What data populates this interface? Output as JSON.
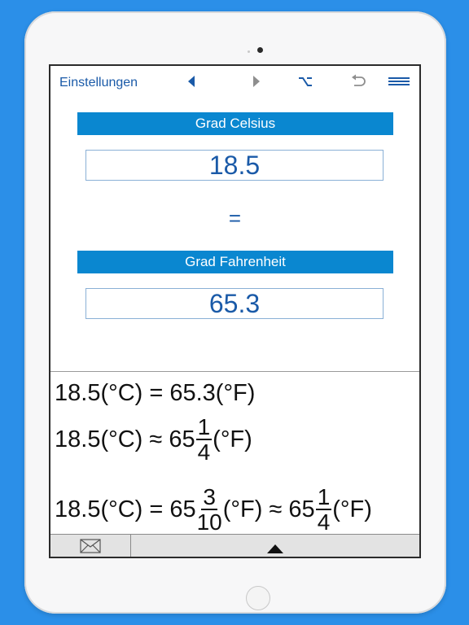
{
  "navbar": {
    "settings_label": "Einstellungen",
    "icons": [
      "back-arrow-icon",
      "forward-arrow-icon",
      "option-key-icon",
      "undo-icon",
      "menu-icon"
    ]
  },
  "converter": {
    "from_unit": "Grad Celsius",
    "from_value": "18.5",
    "equals": "=",
    "to_unit": "Grad Fahrenheit",
    "to_value": "65.3"
  },
  "results": {
    "line1": "18.5(°C) = 65.3(°F)",
    "line2": {
      "prefix": "18.5(°C) ≈ 65",
      "frac_num": "1",
      "frac_den": "4",
      "suffix": "(°F)"
    },
    "line3": {
      "prefix": "18.5(°C) = 65",
      "frac1_num": "3",
      "frac1_den": "10",
      "middle": "(°F) ≈ 65",
      "frac2_num": "1",
      "frac2_den": "4",
      "suffix": "(°F)"
    }
  },
  "bottombar": {
    "mail_icon": "envelope-icon",
    "expand_icon": "triangle-up-icon"
  },
  "colors": {
    "background": "#2b8fe8",
    "accent": "#0a87d0",
    "text_blue": "#1a5aa8"
  }
}
